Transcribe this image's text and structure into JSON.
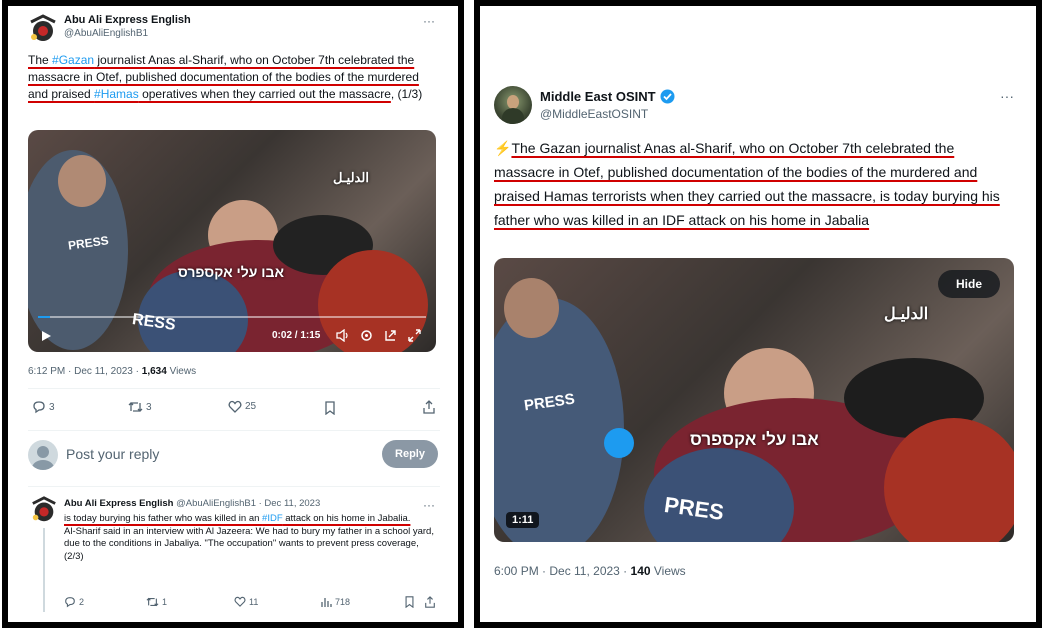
{
  "left": {
    "author": "Abu Ali Express English",
    "handle": "@AbuAliEnglishB1",
    "more": "···",
    "tweet_parts": [
      "The ",
      "#Gazan",
      " journalist Anas al-Sharif, who on October 7th celebrated the massacre in Otef, published documentation of the bodies of the murdered and praised ",
      "#Hamas",
      " operatives when they carried out the massacre",
      ", (1/3)"
    ],
    "video_overlay": "אבו עלי אקספרס",
    "video_press": "PRESS",
    "video_press2": "RESS",
    "video_logo": "الدليـل",
    "video_time": "0:02 / 1:15",
    "timestamp": "6:12 PM · Dec 11, 2023 · ",
    "views_count": "1,634",
    "views_label": " Views",
    "stats": {
      "replies": "3",
      "retweets": "3",
      "likes": "25"
    },
    "reply_placeholder": "Post your reply",
    "reply_button": "Reply",
    "reply": {
      "author": "Abu Ali Express English",
      "meta": " @AbuAliEnglishB1 · Dec 11, 2023",
      "line1_a": "is today burying his father who was killed in an ",
      "line1_tag": "#IDF",
      "line1_b": " attack on his home in Jabalia.",
      "line2": "Al-Sharif said in an interview with Al Jazeera: We had to bury my father in a school yard, due to the conditions in Jabaliya. \"The occupation\" wants to prevent press coverage, (2/3)",
      "stats": {
        "replies": "2",
        "retweets": "1",
        "likes": "11",
        "views": "718"
      }
    }
  },
  "right": {
    "author": "Middle East OSINT",
    "handle": "@MiddleEastOSINT",
    "more": "···",
    "emoji": "⚡",
    "tweet": "The Gazan journalist Anas al-Sharif, who on October 7th celebrated the massacre in Otef, published documentation of the bodies of the murdered and praised Hamas terrorists when they carried out the massacre, is today burying his father who was killed in an IDF attack on his home in Jabalia",
    "video_overlay": "אבו עלי אקספרס",
    "video_press": "PRESS",
    "video_press2": "PRES",
    "video_logo": "الدليـل",
    "hide_button": "Hide",
    "duration": "1:11",
    "timestamp": "6:00 PM · Dec 11, 2023 · ",
    "views_count": "140",
    "views_label": " Views"
  },
  "colors": {
    "accent": "#1d9bf0",
    "underline": "#d00000",
    "muted": "#536471"
  }
}
